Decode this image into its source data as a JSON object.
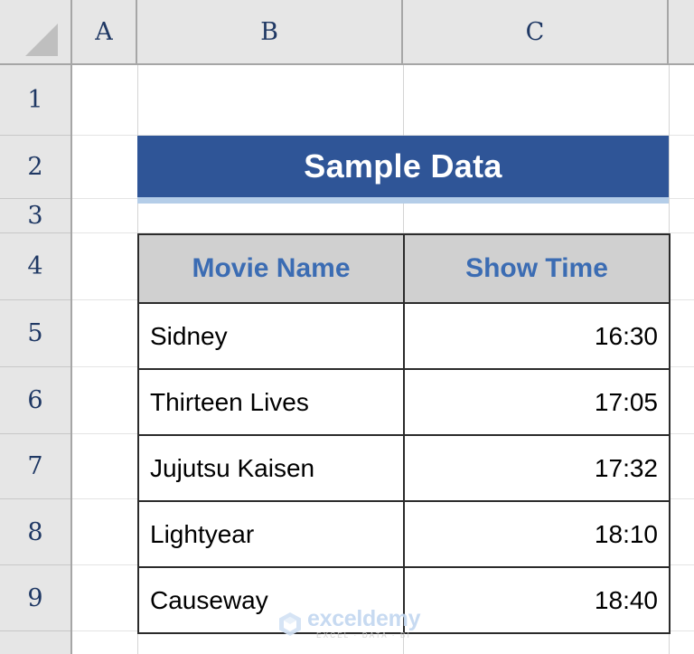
{
  "app": {
    "type": "spreadsheet",
    "column_headers": [
      "A",
      "B",
      "C"
    ],
    "row_headers": [
      "1",
      "2",
      "3",
      "4",
      "5",
      "6",
      "7",
      "8",
      "9"
    ]
  },
  "banner": {
    "title": "Sample Data",
    "fill_color": "#2F5597",
    "text_color": "#FFFFFF",
    "underline_color": "#B4CDE8"
  },
  "table": {
    "headers": [
      "Movie Name",
      "Show Time"
    ],
    "header_fill": "#D0D0D0",
    "header_text_color": "#3B6CB3",
    "rows": [
      {
        "movie": "Sidney",
        "time": "16:30"
      },
      {
        "movie": "Thirteen Lives",
        "time": "17:05"
      },
      {
        "movie": "Jujutsu Kaisen",
        "time": "17:32"
      },
      {
        "movie": "Lightyear",
        "time": "18:10"
      },
      {
        "movie": "Causeway",
        "time": "18:40"
      }
    ]
  },
  "watermark": {
    "name": "exceldemy",
    "tagline": "EXCEL · DATA · BI",
    "icon": "hexagon-logo-icon",
    "color": "#C3D7F0"
  }
}
